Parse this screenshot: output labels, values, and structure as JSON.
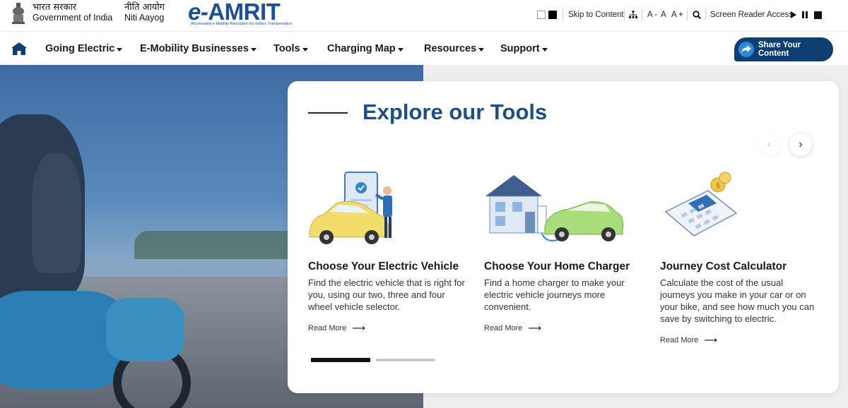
{
  "header": {
    "gov_hindi": "भारत सरकार",
    "gov_english": "Government of India",
    "niti_hindi": "नीति आयोग",
    "niti_english": "Niti Aayog",
    "logo_text": "AMRIT",
    "logo_e": "e-",
    "logo_tagline": "Accelerated e-Mobility Revolution for India's Transportation"
  },
  "utility": {
    "skip_label": "Skip to Content",
    "font_small": "A -",
    "font_normal": "A",
    "font_large": "A +",
    "screen_reader": "Screen Reader Access"
  },
  "nav": {
    "items": [
      {
        "label": "Going Electric"
      },
      {
        "label": "E-Mobility Businesses"
      },
      {
        "label": "Tools"
      },
      {
        "label": "Charging Map"
      },
      {
        "label": "Resources"
      },
      {
        "label": "Support"
      }
    ],
    "share_label": "Share Your Content"
  },
  "tools_section": {
    "title": "Explore our Tools",
    "cards": [
      {
        "title": "Choose Your Electric Vehicle",
        "desc": "Find the electric vehicle that is right for you, using our two, three and four wheel vehicle selector.",
        "link": "Read More"
      },
      {
        "title": "Choose Your Home Charger",
        "desc": "Find a home charger to make your electric vehicle journeys more convenient.",
        "link": "Read More"
      },
      {
        "title": "Journey Cost Calculator",
        "desc": "Calculate the cost of the usual journeys you make in your car or on your bike, and see how much you can save by switching to electric.",
        "link": "Read More"
      }
    ]
  },
  "colors": {
    "brand": "#1b4f87",
    "share_button": "#0e3e72",
    "accent_blue": "#2f86d6",
    "ev_yellow": "#f2dc6a",
    "ev_green": "#a9dc7a"
  }
}
